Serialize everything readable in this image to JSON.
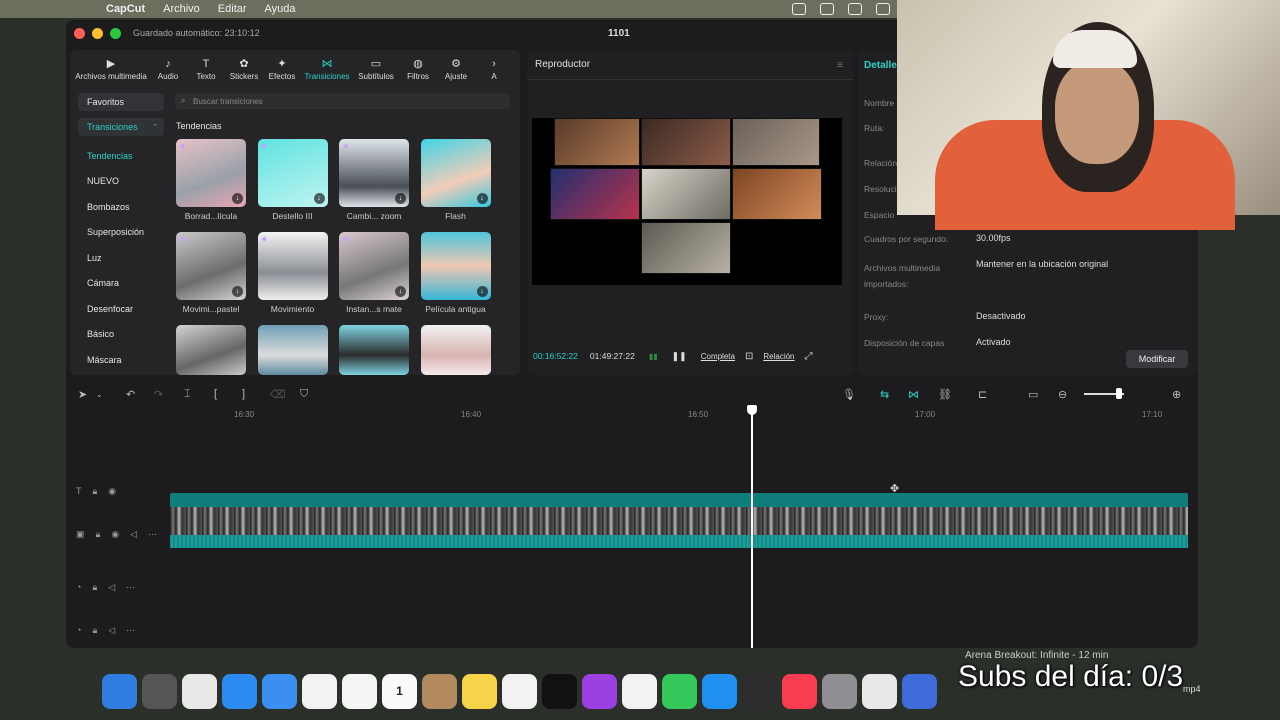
{
  "menubar": {
    "app": "CapCut",
    "items": [
      "Archivo",
      "Editar",
      "Ayuda"
    ]
  },
  "window": {
    "autosave": "Guardado automático: 23:10:12",
    "title": "1101"
  },
  "toolbar": [
    {
      "label": "Archivos multimedia",
      "icon": "media-icon"
    },
    {
      "label": "Audio",
      "icon": "audio-icon"
    },
    {
      "label": "Texto",
      "icon": "text-icon"
    },
    {
      "label": "Stickers",
      "icon": "sticker-icon"
    },
    {
      "label": "Efectos",
      "icon": "effects-icon"
    },
    {
      "label": "Transiciones",
      "icon": "transitions-icon",
      "active": true
    },
    {
      "label": "Subtítulos",
      "icon": "subtitles-icon"
    },
    {
      "label": "Filtros",
      "icon": "filters-icon"
    },
    {
      "label": "Ajuste",
      "icon": "adjust-icon"
    },
    {
      "label": "A",
      "icon": "more-icon"
    }
  ],
  "sidebar": {
    "favorites": "Favoritos",
    "transitions": "Transiciones",
    "items": [
      "Tendencias",
      "NUEVO",
      "Bombazos",
      "Superposición",
      "Luz",
      "Cámara",
      "Desenfocar",
      "Básico",
      "Máscara"
    ]
  },
  "search": {
    "placeholder": "Buscar transiciones"
  },
  "section_title": "Tendencias",
  "cards": [
    {
      "label": "Borrad...lícula"
    },
    {
      "label": "Destello III"
    },
    {
      "label": "Cambi... zoom"
    },
    {
      "label": "Flash"
    },
    {
      "label": "Movimi...pastel"
    },
    {
      "label": "Movimiento"
    },
    {
      "label": "Instan...s mate"
    },
    {
      "label": "Película antigua"
    },
    {
      "label": ""
    },
    {
      "label": ""
    },
    {
      "label": ""
    },
    {
      "label": ""
    }
  ],
  "player": {
    "title": "Reproductor",
    "current_time": "00:16:52:22",
    "total_time": "01:49:27:22",
    "full_label": "Completa",
    "ratio_label": "Relación"
  },
  "details": {
    "title": "Detalle",
    "rows": [
      {
        "label": "Nombre",
        "value": ""
      },
      {
        "label": "Ruta:",
        "value": ""
      },
      {
        "label": "Relación",
        "value": ""
      },
      {
        "label": "Resolución",
        "value": ""
      },
      {
        "label": "Espacio",
        "value": ""
      },
      {
        "label": "Cuadros por segundo:",
        "value": "30.00fps"
      },
      {
        "label": "Archivos multimedia importados:",
        "value": "Mantener en la ubicación original"
      },
      {
        "label": "Proxy:",
        "value": "Desactivado"
      },
      {
        "label": "Disposición de capas",
        "value": "Activado"
      }
    ],
    "modify": "Modificar"
  },
  "timeline": {
    "ticks": [
      "16:30",
      "16:40",
      "16:50",
      "17:00",
      "17:10"
    ],
    "playhead_time": "16:52"
  },
  "dock": [
    "Finder",
    "Calc",
    "Launchpad",
    "Safari",
    "Mail",
    "Chrome",
    "Photos",
    "Calendar",
    "Contacts",
    "Notes",
    "Freeform",
    "TV",
    "Podcasts",
    "Reminders",
    "Messages",
    "App Store",
    "OBS",
    "Music",
    "Settings",
    "Files",
    "Roblox"
  ],
  "dock_date": "1",
  "notification": "Arena Breakout: Infinite - 12 min",
  "overlay": "Subs del día: 0/3",
  "mp4": "mp4",
  "colors": {
    "accent": "#2ad1c9",
    "clip": "#0f7d7a"
  }
}
